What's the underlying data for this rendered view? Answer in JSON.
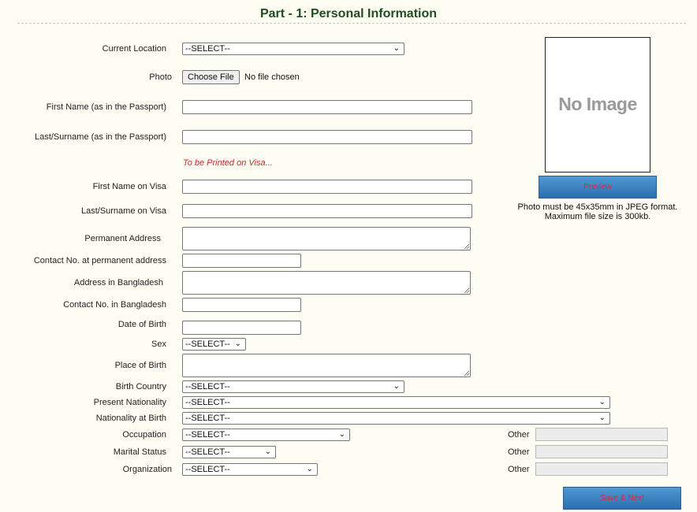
{
  "page": {
    "title": "Part - 1: Personal Information"
  },
  "labels": {
    "current_location": "Current Location",
    "photo": "Photo",
    "first_name_passport": "First Name (as in the Passport)",
    "last_name_passport": "Last/Surname (as in the Passport)",
    "first_name_visa": "First Name on Visa",
    "last_name_visa": "Last/Surname on Visa",
    "permanent_address": "Permanent Address",
    "contact_permanent": "Contact No. at permanent address",
    "address_bd": "Address in Bangladesh",
    "contact_bd": "Contact No. in Bangladesh",
    "dob": "Date of Birth",
    "sex": "Sex",
    "place_of_birth": "Place of Birth",
    "birth_country": "Birth Country",
    "present_nationality": "Present Nationality",
    "nationality_at_birth": "Nationality at Birth",
    "occupation": "Occupation",
    "marital_status": "Marital Status",
    "organization": "Organization",
    "other": "Other"
  },
  "visa_note": "To be Printed on Visa...",
  "selects": {
    "current_location": "--SELECT--",
    "sex": "--SELECT--",
    "birth_country": "--SELECT--",
    "present_nationality": "--SELECT--",
    "nationality_at_birth": "--SELECT--",
    "occupation": "--SELECT--",
    "marital_status": "--SELECT--",
    "organization": "--SELECT--"
  },
  "file": {
    "button": "Choose File",
    "status": "No file chosen"
  },
  "photo_panel": {
    "placeholder": "No Image",
    "preview_button": "Preview",
    "note_line1": "Photo must be 45x35mm in JPEG format.",
    "note_line2": "Maximum file size is 300kb."
  },
  "actions": {
    "save_next": "Save & Next"
  },
  "colors": {
    "title": "#1f4d1f",
    "visa_note": "#c42a2a",
    "button_text": "#e3262c",
    "button_bg": "#2a6fb0"
  }
}
